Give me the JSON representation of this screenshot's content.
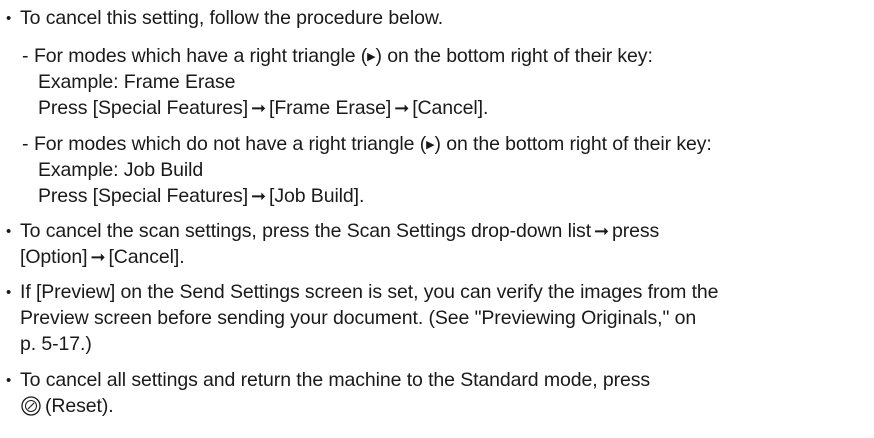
{
  "items": [
    {
      "text": "To cancel this setting, follow the procedure below."
    },
    {
      "sub1_prefix": "For modes which have a right triangle (",
      "sub1_suffix": ") on the bottom right of their key:",
      "sub1_example": "Example: Frame Erase",
      "sub1_press_a": "Press [Special Features]",
      "sub1_press_b": "[Frame Erase]",
      "sub1_press_c": "[Cancel]."
    },
    {
      "sub2_prefix": "For modes which do not have a right triangle (",
      "sub2_suffix": ") on the bottom right of their key:",
      "sub2_example": "Example: Job Build",
      "sub2_press_a": "Press [Special Features]",
      "sub2_press_b": "[Job Build]."
    },
    {
      "line1_a": "To cancel the scan settings, press the Scan Settings drop-down list",
      "line1_b": "press",
      "line2_a": "[Option]",
      "line2_b": "[Cancel]."
    },
    {
      "line1": "If [Preview] on the Send Settings screen is set, you can verify the images from the",
      "line2": "Preview screen before sending your document. (See \"Previewing Originals,\" on",
      "line3": "p. 5-17.)"
    },
    {
      "line1": "To cancel all settings and return the machine to the Standard mode, press",
      "line2": "(Reset)."
    }
  ],
  "symbols": {
    "bullet": "•",
    "dash": "-",
    "triangle": "▶",
    "arrow": "➞"
  },
  "icons": {
    "triangle": "right-triangle-icon",
    "arrow": "right-arrow-icon",
    "reset": "reset-key-icon"
  }
}
